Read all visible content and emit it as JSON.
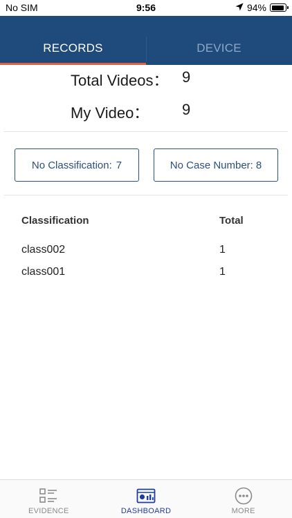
{
  "status_bar": {
    "carrier": "No SIM",
    "time": "9:56",
    "battery_percent_label": "94%",
    "battery_level": 0.94
  },
  "tabs": [
    {
      "label": "RECORDS",
      "active": true
    },
    {
      "label": "DEVICE",
      "active": false
    }
  ],
  "summary": {
    "total_videos": {
      "label": "Total Videos：",
      "value": "9"
    },
    "my_video": {
      "label": "My Video：",
      "value": "9"
    }
  },
  "filters": {
    "no_classification": {
      "label": "No Classification:",
      "count": "7"
    },
    "no_case_number": {
      "label": "No Case Number:",
      "count": "8"
    }
  },
  "table": {
    "headers": [
      "Classification",
      "Total"
    ],
    "rows": [
      {
        "classification": "class002",
        "total": "1"
      },
      {
        "classification": "class001",
        "total": "1"
      }
    ]
  },
  "bottom_nav": [
    {
      "label": "EVIDENCE",
      "icon": "evidence-list-icon",
      "active": false
    },
    {
      "label": "DASHBOARD",
      "icon": "dashboard-chart-icon",
      "active": true
    },
    {
      "label": "MORE",
      "icon": "more-dots-icon",
      "active": false
    }
  ],
  "colors": {
    "header_bg": "#1f4a7c",
    "tab_indicator": "#e85d44",
    "button_border": "#2b4f7e",
    "nav_active": "#1e3c9c"
  }
}
